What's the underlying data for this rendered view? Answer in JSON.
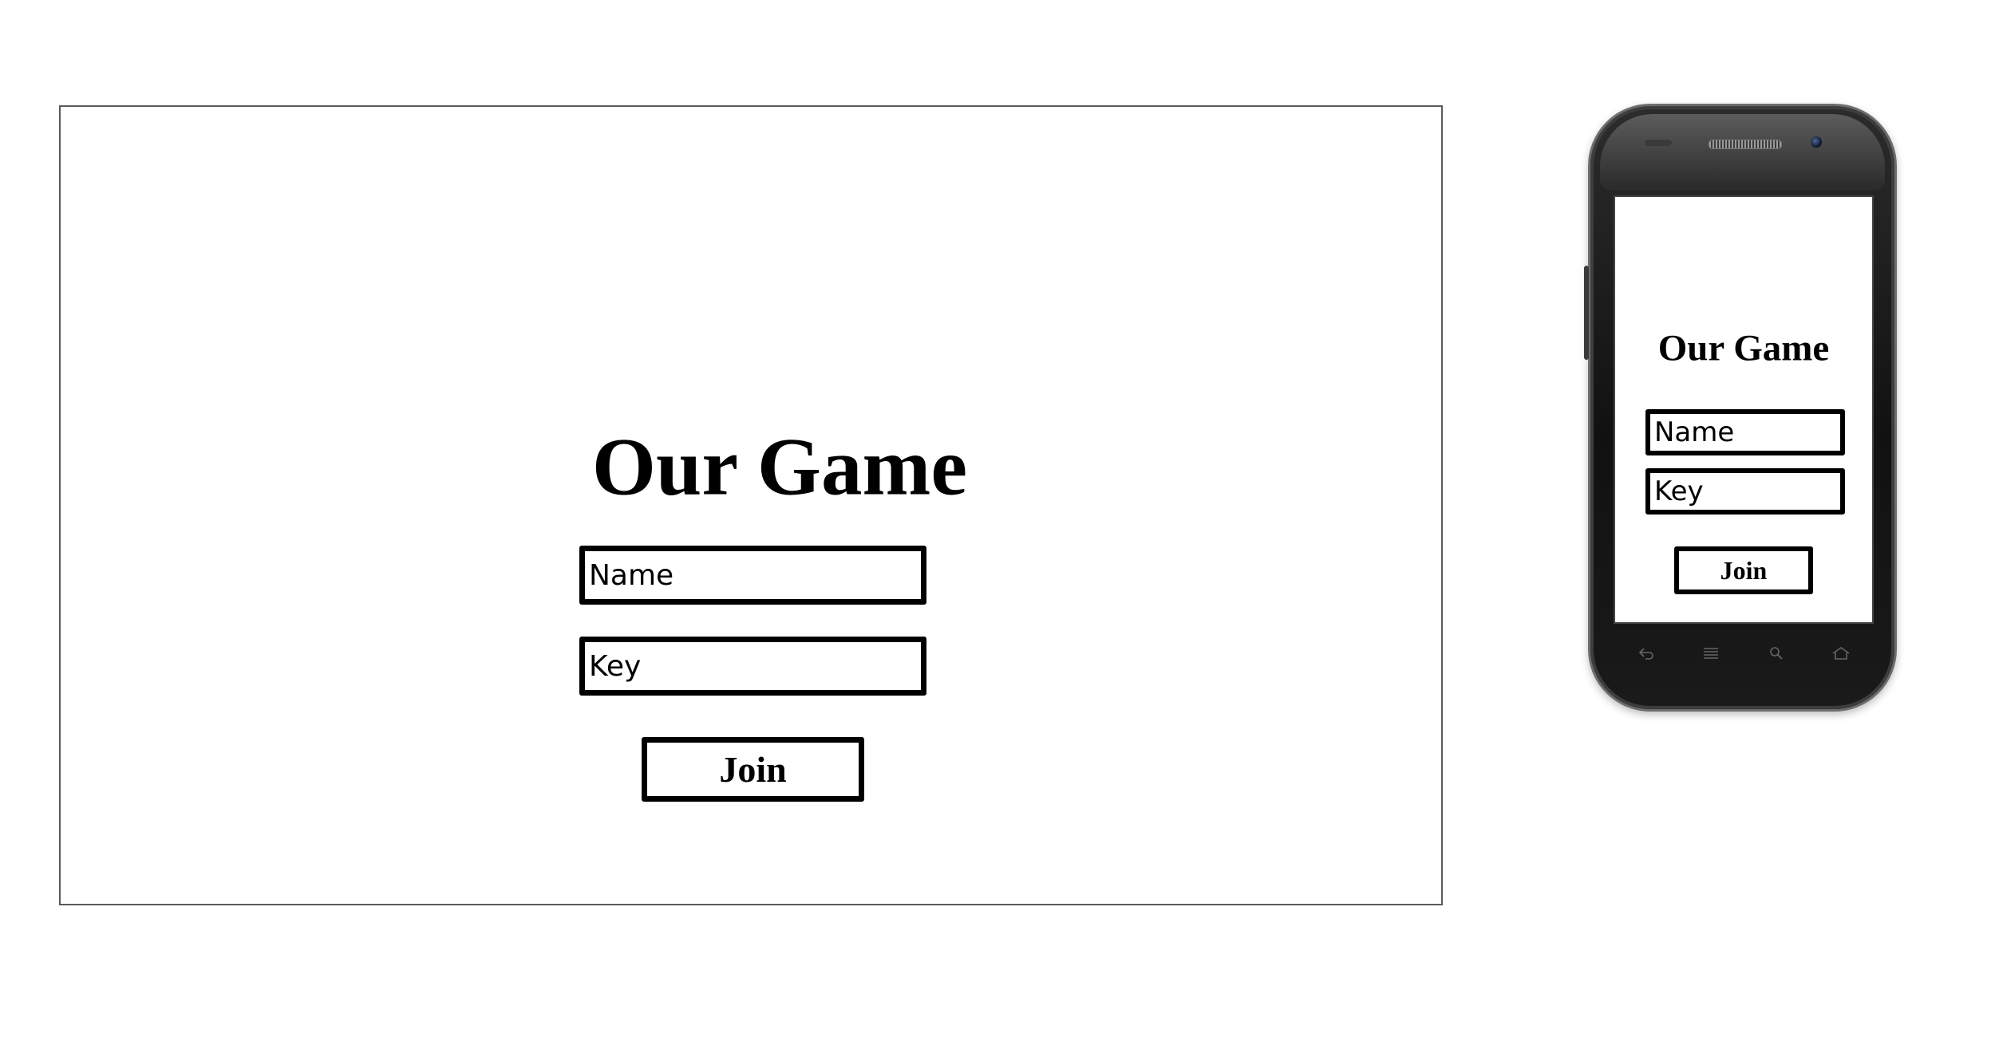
{
  "desktop": {
    "title": "Our Game",
    "name_field": "Name",
    "key_field": "Key",
    "join_button": "Join"
  },
  "mobile": {
    "title": "Our Game",
    "name_field": "Name",
    "key_field": "Key",
    "join_button": "Join",
    "nav_icons": [
      "back-icon",
      "menu-icon",
      "search-icon",
      "home-icon"
    ]
  }
}
